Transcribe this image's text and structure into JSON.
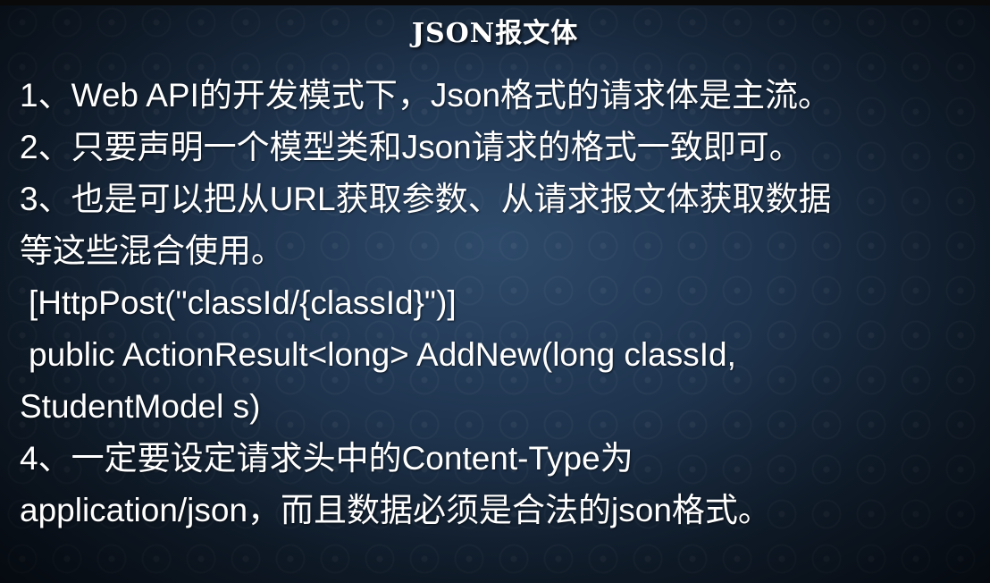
{
  "slide": {
    "title": "JSON报文体",
    "lines": [
      "1、Web API的开发模式下，Json格式的请求体是主流。",
      "2、只要声明一个模型类和Json请求的格式一致即可。",
      "3、也是可以把从URL获取参数、从请求报文体获取数据",
      "等这些混合使用。",
      "[HttpPost(\"classId/{classId}\")]",
      "public ActionResult<long> AddNew(long classId,",
      "StudentModel s)",
      "4、一定要设定请求头中的Content-Type为",
      "application/json，而且数据必须是合法的json格式。"
    ]
  }
}
